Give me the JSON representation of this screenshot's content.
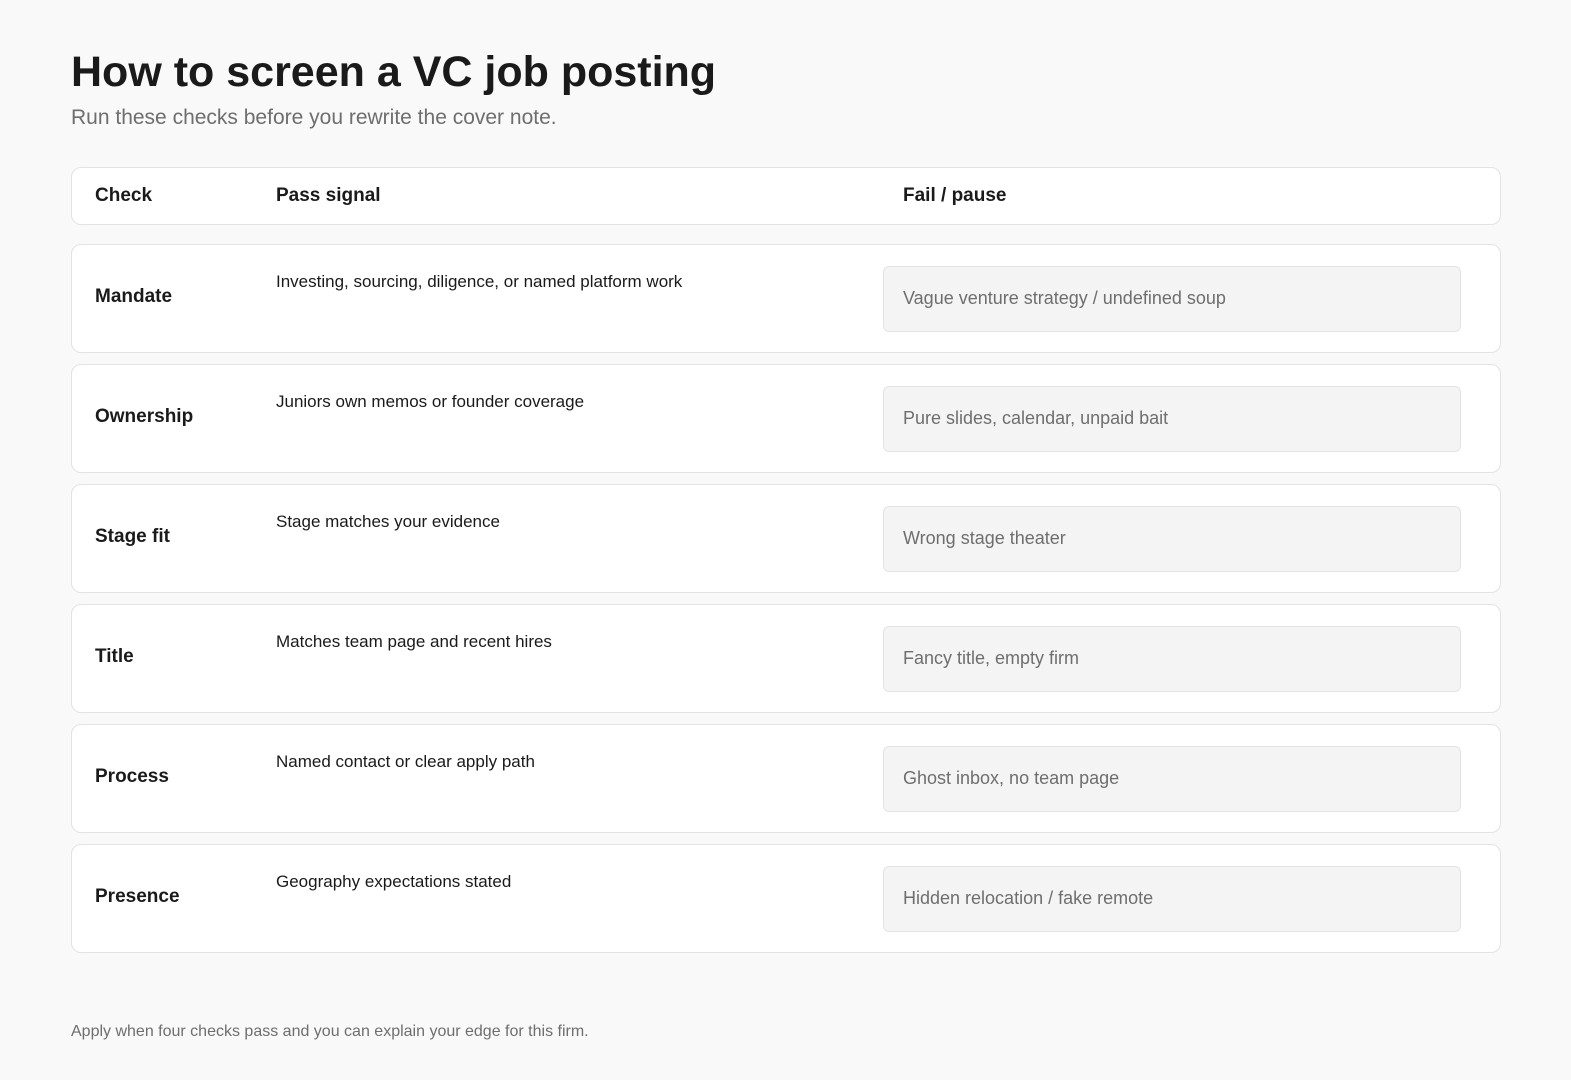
{
  "title": "How to screen a VC job posting",
  "subtitle": "Run these checks before you rewrite the cover note.",
  "table": {
    "headers": {
      "check": "Check",
      "pass": "Pass signal",
      "fail": "Fail / pause"
    },
    "rows": [
      {
        "check": "Mandate",
        "pass": "Investing, sourcing, diligence, or named platform work",
        "fail": "Vague venture strategy / undefined soup"
      },
      {
        "check": "Ownership",
        "pass": "Juniors own memos or founder coverage",
        "fail": "Pure slides, calendar, unpaid bait"
      },
      {
        "check": "Stage fit",
        "pass": "Stage matches your evidence",
        "fail": "Wrong stage theater"
      },
      {
        "check": "Title",
        "pass": "Matches team page and recent hires",
        "fail": "Fancy title, empty firm"
      },
      {
        "check": "Process",
        "pass": "Named contact or clear apply path",
        "fail": "Ghost inbox, no team page"
      },
      {
        "check": "Presence",
        "pass": "Geography expectations stated",
        "fail": "Hidden relocation / fake remote"
      }
    ]
  },
  "footer": "Apply when four checks pass and you can explain your edge for this firm."
}
